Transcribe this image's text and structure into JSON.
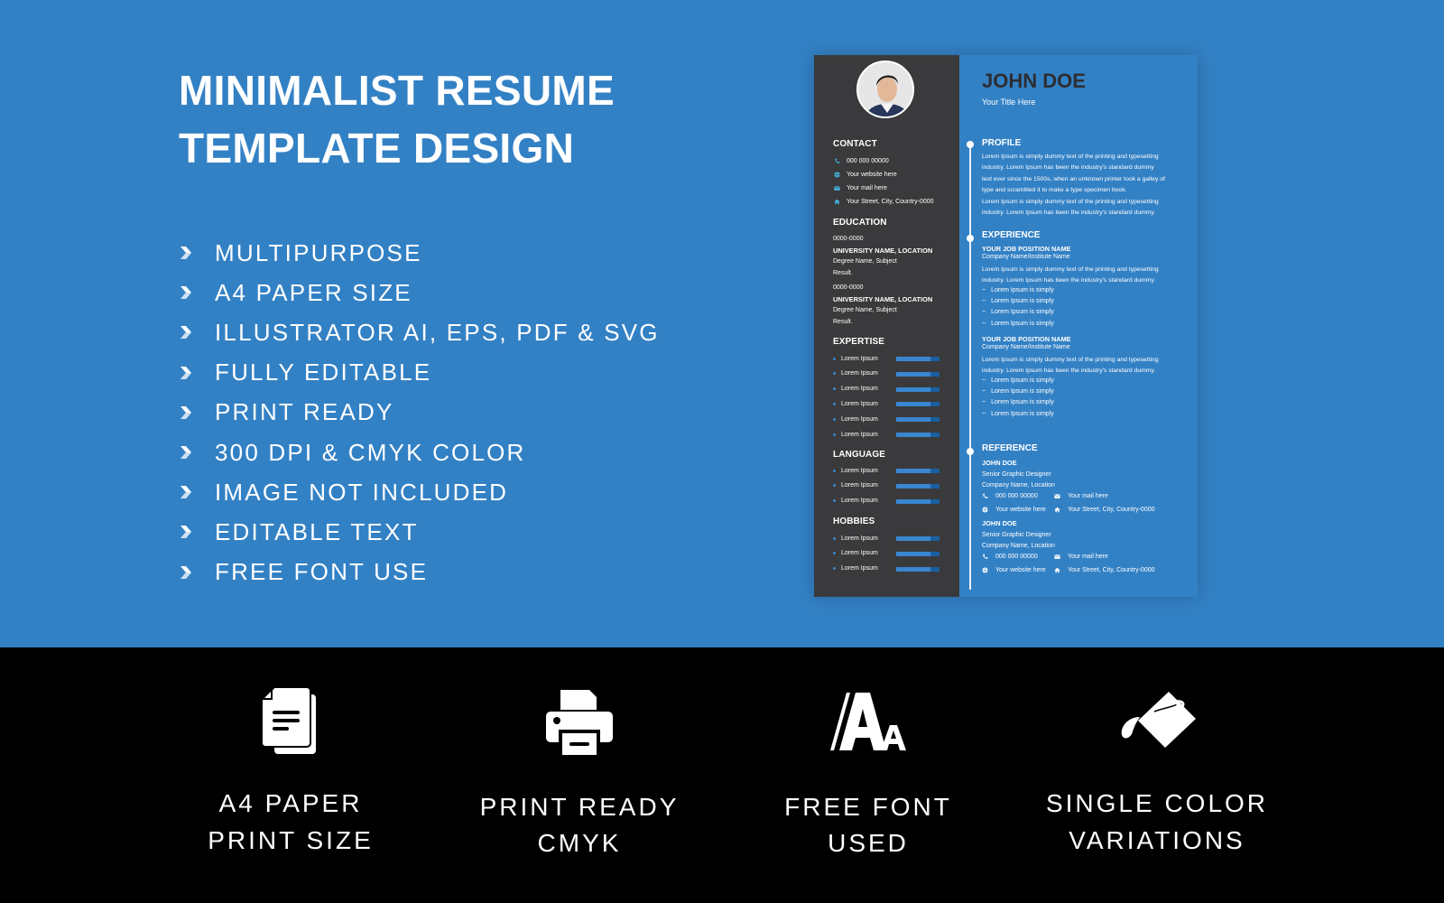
{
  "headline": {
    "line1": "MINIMALIST RESUME",
    "line2": "TEMPLATE DESIGN"
  },
  "features": [
    "MULTIPURPOSE",
    "A4 PAPER SIZE",
    "ILLUSTRATOR AI, EPS, PDF & SVG",
    "FULLY EDITABLE",
    "PRINT READY",
    "300 DPI & CMYK COLOR",
    "IMAGE NOT INCLUDED",
    "EDITABLE TEXT",
    "FREE FONT USE"
  ],
  "colors": {
    "brand_blue": "#3381c5",
    "sidebar": "#3a3a3c",
    "bottom_bg": "#000000",
    "name_text": "#2d2d33"
  },
  "resume": {
    "name": "JOHN DOE",
    "title": "Your Title Here",
    "contact": {
      "heading": "CONTACT",
      "phone": "000 000 00000",
      "website": "Your website here",
      "mail": "Your mail here",
      "address": "Your Street, City, Country-0000"
    },
    "education": {
      "heading": "EDUCATION",
      "items": [
        {
          "years": "0000-0000",
          "school": "UNIVERSITY NAME, LOCATION",
          "degree": "Degree Name, Subject",
          "result": "Result."
        },
        {
          "years": "0000-0000",
          "school": "UNIVERSITY NAME, LOCATION",
          "degree": "Degree Name, Subject",
          "result": "Result."
        }
      ]
    },
    "expertise": {
      "heading": "EXPERTISE",
      "items": [
        {
          "label": "Lorem Ipsum",
          "level": 0.8
        },
        {
          "label": "Lorem Ipsum",
          "level": 0.8
        },
        {
          "label": "Lorem Ipsum",
          "level": 0.8
        },
        {
          "label": "Lorem Ipsum",
          "level": 0.8
        },
        {
          "label": "Lorem Ipsum",
          "level": 0.8
        },
        {
          "label": "Lorem Ipsum",
          "level": 0.8
        }
      ]
    },
    "language": {
      "heading": "LANGUAGE",
      "items": [
        {
          "label": "Lorem Ipsum",
          "level": 0.8
        },
        {
          "label": "Lorem Ipsum",
          "level": 0.8
        },
        {
          "label": "Lorem Ipsum",
          "level": 0.8
        }
      ]
    },
    "hobbies": {
      "heading": "HOBBIES",
      "items": [
        {
          "label": "Lorem Ipsum",
          "level": 0.8
        },
        {
          "label": "Lorem Ipsum",
          "level": 0.8
        },
        {
          "label": "Lorem Ipsum",
          "level": 0.8
        }
      ]
    },
    "profile": {
      "heading": "PROFILE",
      "lines": [
        "Lorem Ipsum is simply dummy text of the printing and typesetting",
        "industry. Lorem Ipsum has been the industry's standard dummy",
        "text ever since the 1500s, when an unknown printer took a galley of",
        "type and scrambled it to make a type specimen book.",
        "Lorem Ipsum is simply dummy text of the printing and typesetting",
        "industry. Lorem Ipsum has been the industry's standard dummy."
      ]
    },
    "experience": {
      "heading": "EXPERIENCE",
      "jobs": [
        {
          "position": "YOUR JOB POSITION NAME",
          "company": "Company Name/Institute Name",
          "lines": [
            " Lorem Ipsum is simply dummy text of the printing and typesetting",
            "industry. Lorem Ipsum has been the industry's standard dummy."
          ],
          "bullets": [
            "Lorem Ipsum is simply",
            "Lorem Ipsum is simply",
            "Lorem Ipsum is simply",
            "Lorem Ipsum is simply"
          ]
        },
        {
          "position": "YOUR JOB POSITION NAME",
          "company": "Company Name/Institute Name",
          "lines": [
            " Lorem Ipsum is simply dummy text of the printing and typesetting",
            "industry. Lorem Ipsum has been the industry's standard dummy."
          ],
          "bullets": [
            "Lorem Ipsum is simply",
            "Lorem Ipsum is simply",
            "Lorem Ipsum is simply",
            "Lorem Ipsum is simply"
          ]
        }
      ]
    },
    "reference": {
      "heading": "REFERENCE",
      "items": [
        {
          "name": "JOHN DOE",
          "role": "Senior Graphic Designer",
          "company": "Company Name, Location",
          "phone": "000 000 00000",
          "mail": "Your mail here",
          "website": "Your website here",
          "address": "Your Street, City, Country-0000"
        },
        {
          "name": "JOHN DOE",
          "role": "Senior Graphic Designer",
          "company": "Company Name, Location",
          "phone": "000 000 00000",
          "mail": "Your mail here",
          "website": "Your website here",
          "address": "Your Street, City, Country-0000"
        }
      ]
    }
  },
  "bottom_features": [
    {
      "icon": "document-icon",
      "line1": "A4 PAPER",
      "line2": "PRINT SIZE"
    },
    {
      "icon": "printer-icon",
      "line1": "PRINT READY",
      "line2": "CMYK"
    },
    {
      "icon": "font-icon",
      "line1": "FREE FONT",
      "line2": "USED"
    },
    {
      "icon": "paint-bucket-icon",
      "line1": "SINGLE COLOR",
      "line2": "VARIATIONS"
    }
  ]
}
